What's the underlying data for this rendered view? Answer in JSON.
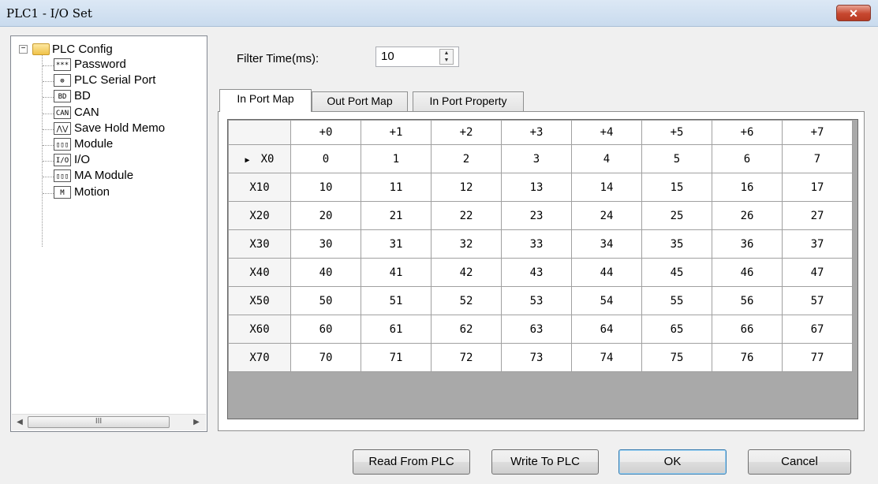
{
  "window": {
    "title": "PLC1 - I/O Set",
    "close_glyph": "✕"
  },
  "tree": {
    "root": {
      "label": "PLC Config",
      "expander": "−",
      "icon": "folder-icon"
    },
    "items": [
      {
        "label": "Password",
        "icon_text": "***",
        "icon": "password-icon"
      },
      {
        "label": "PLC Serial Port",
        "icon_text": "⊕",
        "icon": "serial-port-icon"
      },
      {
        "label": "BD",
        "icon_text": "BD",
        "icon": "bd-icon"
      },
      {
        "label": "CAN",
        "icon_text": "CAN",
        "icon": "can-icon"
      },
      {
        "label": "Save Hold Memo",
        "icon_text": "⋀⋁",
        "icon": "wave-icon"
      },
      {
        "label": "Module",
        "icon_text": "▯▯▯",
        "icon": "module-icon"
      },
      {
        "label": "I/O",
        "icon_text": "I/O",
        "icon": "io-icon"
      },
      {
        "label": "MA Module",
        "icon_text": "▯▯▯",
        "icon": "module-icon"
      },
      {
        "label": "Motion",
        "icon_text": "M",
        "icon": "motion-icon"
      }
    ],
    "scroll": {
      "left": "◀",
      "right": "▶",
      "thumb": "III"
    }
  },
  "filter": {
    "label": "Filter Time(ms):",
    "value": "10",
    "up": "▲",
    "down": "▼"
  },
  "tabs": [
    {
      "label": "In Port Map",
      "active": true
    },
    {
      "label": "Out Port Map",
      "active": false
    },
    {
      "label": "In Port Property",
      "active": false
    }
  ],
  "grid": {
    "columns": [
      "+0",
      "+1",
      "+2",
      "+3",
      "+4",
      "+5",
      "+6",
      "+7"
    ],
    "current_row_marker": "▶",
    "rows": [
      {
        "head": "X0",
        "cells": [
          "0",
          "1",
          "2",
          "3",
          "4",
          "5",
          "6",
          "7"
        ]
      },
      {
        "head": "X10",
        "cells": [
          "10",
          "11",
          "12",
          "13",
          "14",
          "15",
          "16",
          "17"
        ]
      },
      {
        "head": "X20",
        "cells": [
          "20",
          "21",
          "22",
          "23",
          "24",
          "25",
          "26",
          "27"
        ]
      },
      {
        "head": "X30",
        "cells": [
          "30",
          "31",
          "32",
          "33",
          "34",
          "35",
          "36",
          "37"
        ]
      },
      {
        "head": "X40",
        "cells": [
          "40",
          "41",
          "42",
          "43",
          "44",
          "45",
          "46",
          "47"
        ]
      },
      {
        "head": "X50",
        "cells": [
          "50",
          "51",
          "52",
          "53",
          "54",
          "55",
          "56",
          "57"
        ]
      },
      {
        "head": "X60",
        "cells": [
          "60",
          "61",
          "62",
          "63",
          "64",
          "65",
          "66",
          "67"
        ]
      },
      {
        "head": "X70",
        "cells": [
          "70",
          "71",
          "72",
          "73",
          "74",
          "75",
          "76",
          "77"
        ]
      }
    ]
  },
  "buttons": {
    "read": "Read From PLC",
    "write": "Write To PLC",
    "ok": "OK",
    "cancel": "Cancel"
  }
}
